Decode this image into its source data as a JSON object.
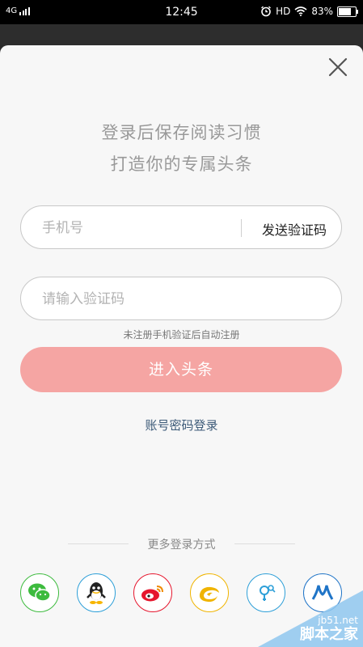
{
  "status_bar": {
    "network": "4G",
    "time": "12:45",
    "hd": "HD",
    "battery": "83%",
    "battery_level": 0.83
  },
  "headline": {
    "line1": "登录后保存阅读习惯",
    "line2": "打造你的专属头条"
  },
  "phone_field": {
    "placeholder": "手机号",
    "value": "",
    "send_code_label": "发送验证码"
  },
  "code_field": {
    "placeholder": "请输入验证码",
    "value": ""
  },
  "hint": "未注册手机验证后自动注册",
  "submit_label": "进入头条",
  "password_login_label": "账号密码登录",
  "more_login_label": "更多登录方式",
  "social_logins": [
    {
      "icon": "wechat-icon",
      "color": "#3dbb3e"
    },
    {
      "icon": "qq-icon",
      "color": "#2d9fd8"
    },
    {
      "icon": "weibo-icon",
      "color": "#e6162d"
    },
    {
      "icon": "tianyi-icon",
      "color": "#f0b400"
    },
    {
      "icon": "other-login-icon",
      "color": "#2d9fd8"
    },
    {
      "icon": "renren-icon",
      "color": "#1f74c7"
    }
  ],
  "watermark": {
    "url": "jb51.net",
    "name": "脚本之家"
  },
  "colors": {
    "accent": "#f5a5a3",
    "link": "#3c5a78"
  }
}
